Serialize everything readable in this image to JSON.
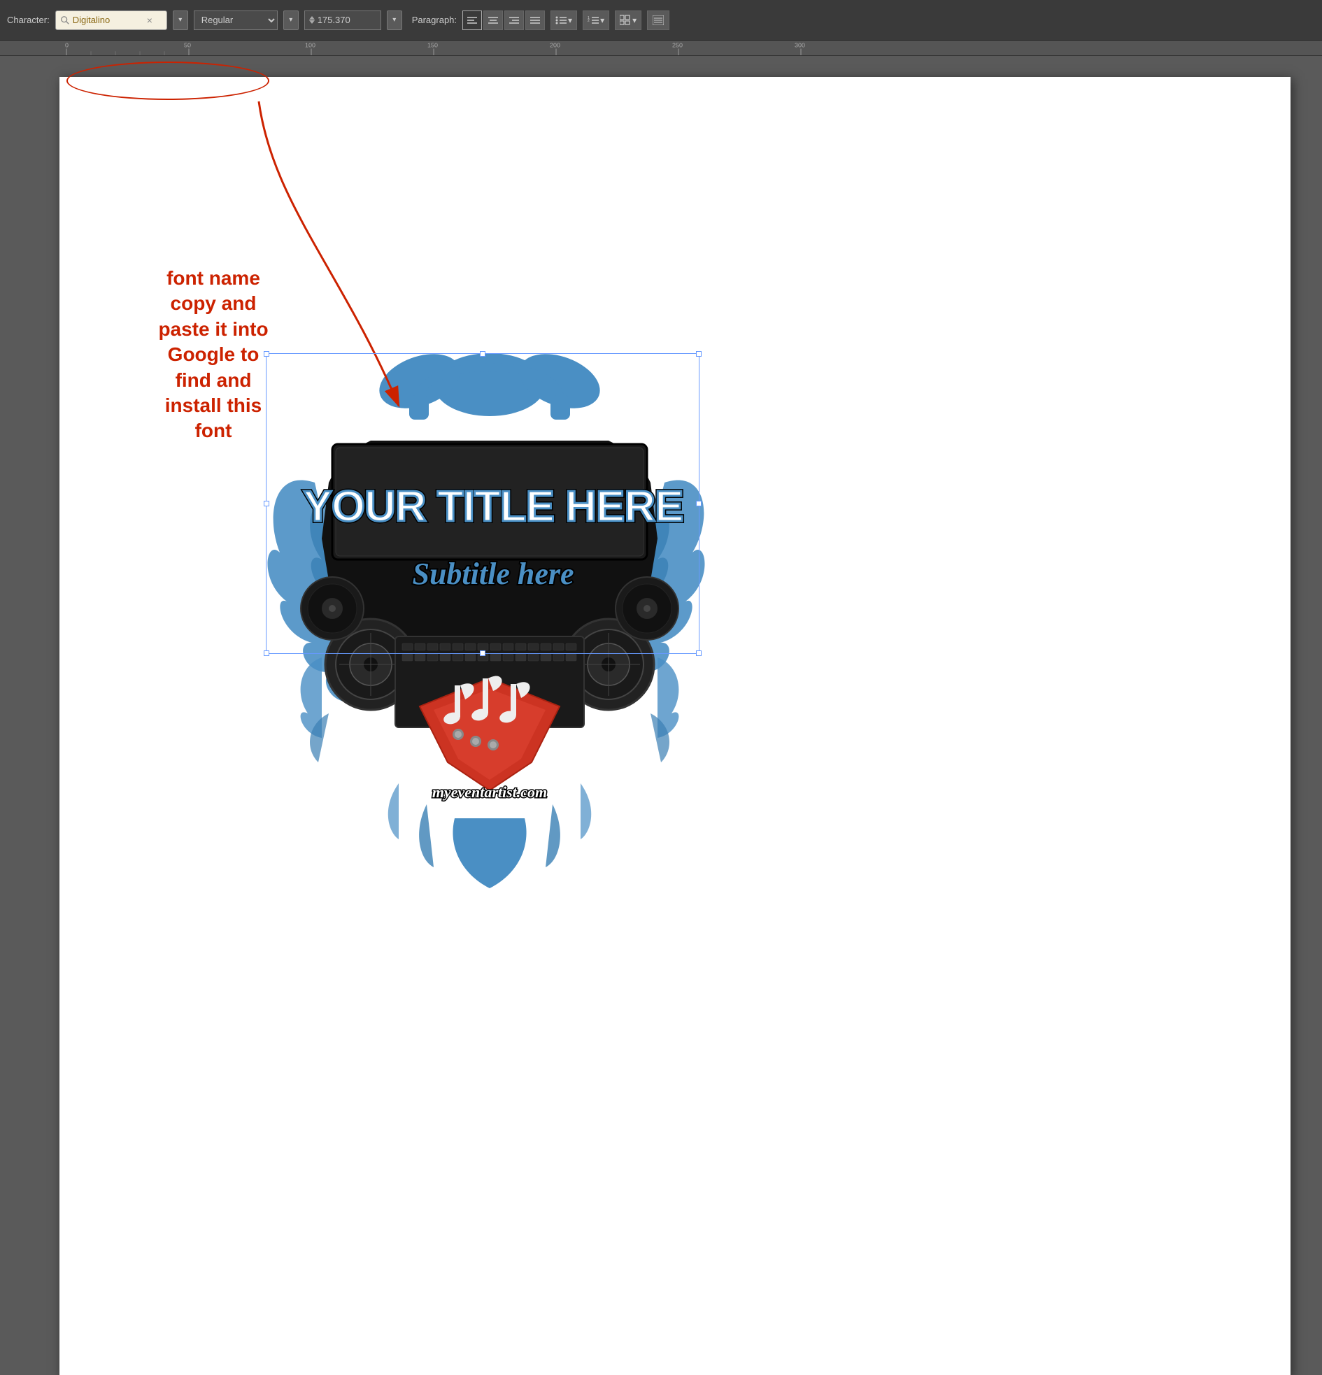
{
  "toolbar": {
    "character_label": "Character:",
    "font_name": "Digitalino",
    "font_style": "Regular",
    "font_size": "175.370",
    "paragraph_label": "Paragraph:",
    "clear_btn": "×",
    "dropdown_arrow": "▾"
  },
  "ruler": {
    "marks": [
      "0",
      "50",
      "100",
      "150",
      "200",
      "250",
      "300"
    ]
  },
  "annotation": {
    "text": "font name copy and paste it into Google to find and install this font"
  },
  "design": {
    "title_text": "YOUR TITLE HERE",
    "subtitle_text": "Subtitle here",
    "website_text": "myeventartist.com"
  },
  "colors": {
    "toolbar_bg": "#3a3a3a",
    "canvas_bg": "#5a5a5a",
    "annotation_red": "#cc2200",
    "selection_blue": "#6699ff",
    "design_blue": "#4a8fc4",
    "accent_red": "#cc3322"
  }
}
